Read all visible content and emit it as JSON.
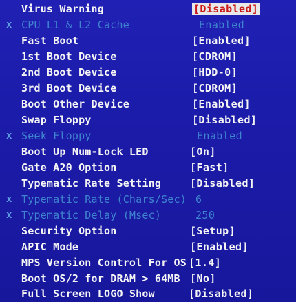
{
  "colors": {
    "background": "#1b1ba8",
    "text": "#f4f4f4",
    "disabled_text": "#3f84cf",
    "highlight_bg": "#e8e8e8",
    "highlight_text": "#c81818"
  },
  "settings": [
    {
      "marker": "",
      "label": "Virus Warning",
      "value": "[Disabled]",
      "state": "selected"
    },
    {
      "marker": "x",
      "label": "CPU L1 & L2 Cache",
      "value": "Enabled",
      "state": "unavailable"
    },
    {
      "marker": "",
      "label": "Fast Boot",
      "value": "[Enabled]",
      "state": "normal"
    },
    {
      "marker": "",
      "label": "1st Boot Device",
      "value": "[CDROM]",
      "state": "normal"
    },
    {
      "marker": "",
      "label": "2nd Boot Device",
      "value": "[HDD-0]",
      "state": "normal"
    },
    {
      "marker": "",
      "label": "3rd Boot Device",
      "value": "[CDROM]",
      "state": "normal"
    },
    {
      "marker": "",
      "label": "Boot Other Device",
      "value": "[Enabled]",
      "state": "normal"
    },
    {
      "marker": "",
      "label": "Swap Floppy",
      "value": "[Disabled]",
      "state": "normal"
    },
    {
      "marker": "x",
      "label": "Seek Floppy",
      "value": "Enabled",
      "state": "unavailable"
    },
    {
      "marker": "",
      "label": "Boot Up Num-Lock LED",
      "value": "[On]",
      "state": "normal"
    },
    {
      "marker": "",
      "label": "Gate A20 Option",
      "value": "[Fast]",
      "state": "normal"
    },
    {
      "marker": "",
      "label": "Typematic Rate Setting",
      "value": "[Disabled]",
      "state": "normal"
    },
    {
      "marker": "x",
      "label": "Typematic Rate (Chars/Sec)",
      "value": "6",
      "state": "unavailable"
    },
    {
      "marker": "x",
      "label": "Typematic Delay (Msec)",
      "value": "250",
      "state": "unavailable"
    },
    {
      "marker": "",
      "label": "Security Option",
      "value": "[Setup]",
      "state": "normal"
    },
    {
      "marker": "",
      "label": "APIC Mode",
      "value": "[Enabled]",
      "state": "normal"
    },
    {
      "marker": "",
      "label": "MPS Version Control For OS",
      "value": "[1.4]",
      "state": "normal"
    },
    {
      "marker": "",
      "label": "Boot OS/2 for DRAM > 64MB",
      "value": "[No]",
      "state": "normal"
    },
    {
      "marker": "",
      "label": "Full Screen LOGO Show",
      "value": "[Disabled]",
      "state": "normal"
    }
  ]
}
